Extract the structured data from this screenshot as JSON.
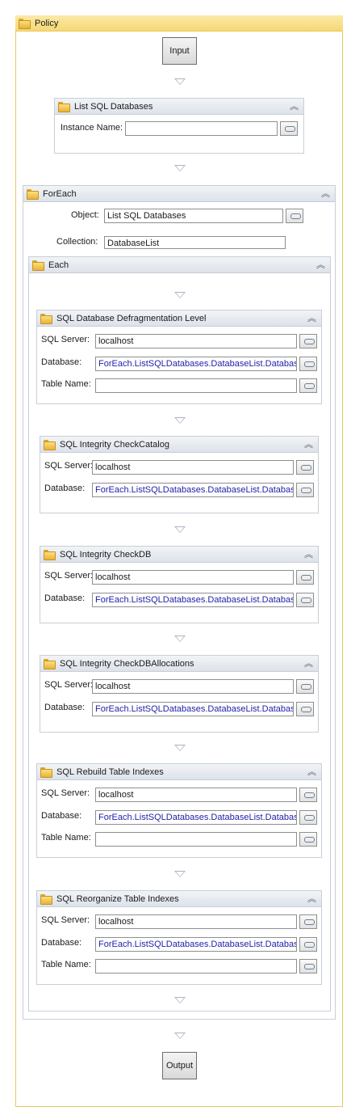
{
  "policy": {
    "title": "Policy"
  },
  "input_button": "Input",
  "output_button": "Output",
  "list_sql": {
    "title": "List SQL Databases",
    "instance_label": "Instance Name:",
    "instance_value": ""
  },
  "foreach": {
    "title": "ForEach",
    "object_label": "Object:",
    "object_value": "List SQL Databases",
    "collection_label": "Collection:",
    "collection_value": "DatabaseList"
  },
  "each": {
    "title": "Each"
  },
  "labels": {
    "sql_server": "SQL Server:",
    "database": "Database:",
    "table_name": "Table Name:"
  },
  "activities": [
    {
      "title": "SQL Database Defragmentation Level",
      "sql_server": "localhost",
      "database": "ForEach.ListSQLDatabases.DatabaseList.Database",
      "table_name": ""
    },
    {
      "title": "SQL Integrity CheckCatalog",
      "sql_server": "localhost",
      "database": "ForEach.ListSQLDatabases.DatabaseList.Database"
    },
    {
      "title": "SQL Integrity CheckDB",
      "sql_server": "localhost",
      "database": "ForEach.ListSQLDatabases.DatabaseList.Database"
    },
    {
      "title": "SQL Integrity CheckDBAllocations",
      "sql_server": "localhost",
      "database": "ForEach.ListSQLDatabases.DatabaseList.Database"
    },
    {
      "title": "SQL Rebuild Table Indexes",
      "sql_server": "localhost",
      "database": "ForEach.ListSQLDatabases.DatabaseList.Database",
      "table_name": ""
    },
    {
      "title": "SQL Reorganize Table Indexes",
      "sql_server": "localhost",
      "database": "ForEach.ListSQLDatabases.DatabaseList.Database",
      "table_name": ""
    }
  ],
  "icons": {
    "activity": "folder-icon",
    "collapse": "chevron-up-icon",
    "binding": "link-binding-icon",
    "flow": "arrow-down-icon"
  },
  "colors": {
    "policy_border": "#e8c862",
    "policy_header": "#f6d873",
    "link_text": "#2222aa"
  }
}
